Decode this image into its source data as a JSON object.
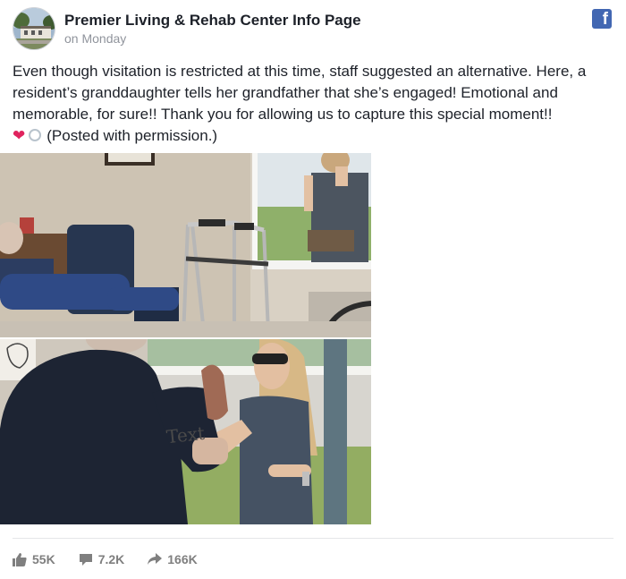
{
  "post": {
    "page_name": "Premier Living & Rehab Center Info Page",
    "timestamp": "on Monday",
    "text_line1": "Even though visitation is restricted at this time, staff suggested an alternative. Here, a resident’s granddaughter tells her grandfather that she’s engaged! Emotional and memorable, for sure!! Thank you for allowing us to capture this special moment!!",
    "text_line2": "(Posted with permission.)",
    "photo_overlay_text": "Text"
  },
  "stats": {
    "likes": "55K",
    "comments": "7.2K",
    "shares": "166K"
  },
  "icons": {
    "avatar": "building-photo",
    "brand": "facebook-icon",
    "emoji1": "red-heart-emoji",
    "emoji2": "ring-emoji",
    "like": "thumbs-up-icon",
    "comment": "comment-bubble-icon",
    "share": "share-arrow-icon"
  },
  "colors": {
    "facebook_blue": "#4267b2",
    "meta_gray": "#90949c",
    "stat_gray": "#7f7f7f"
  }
}
